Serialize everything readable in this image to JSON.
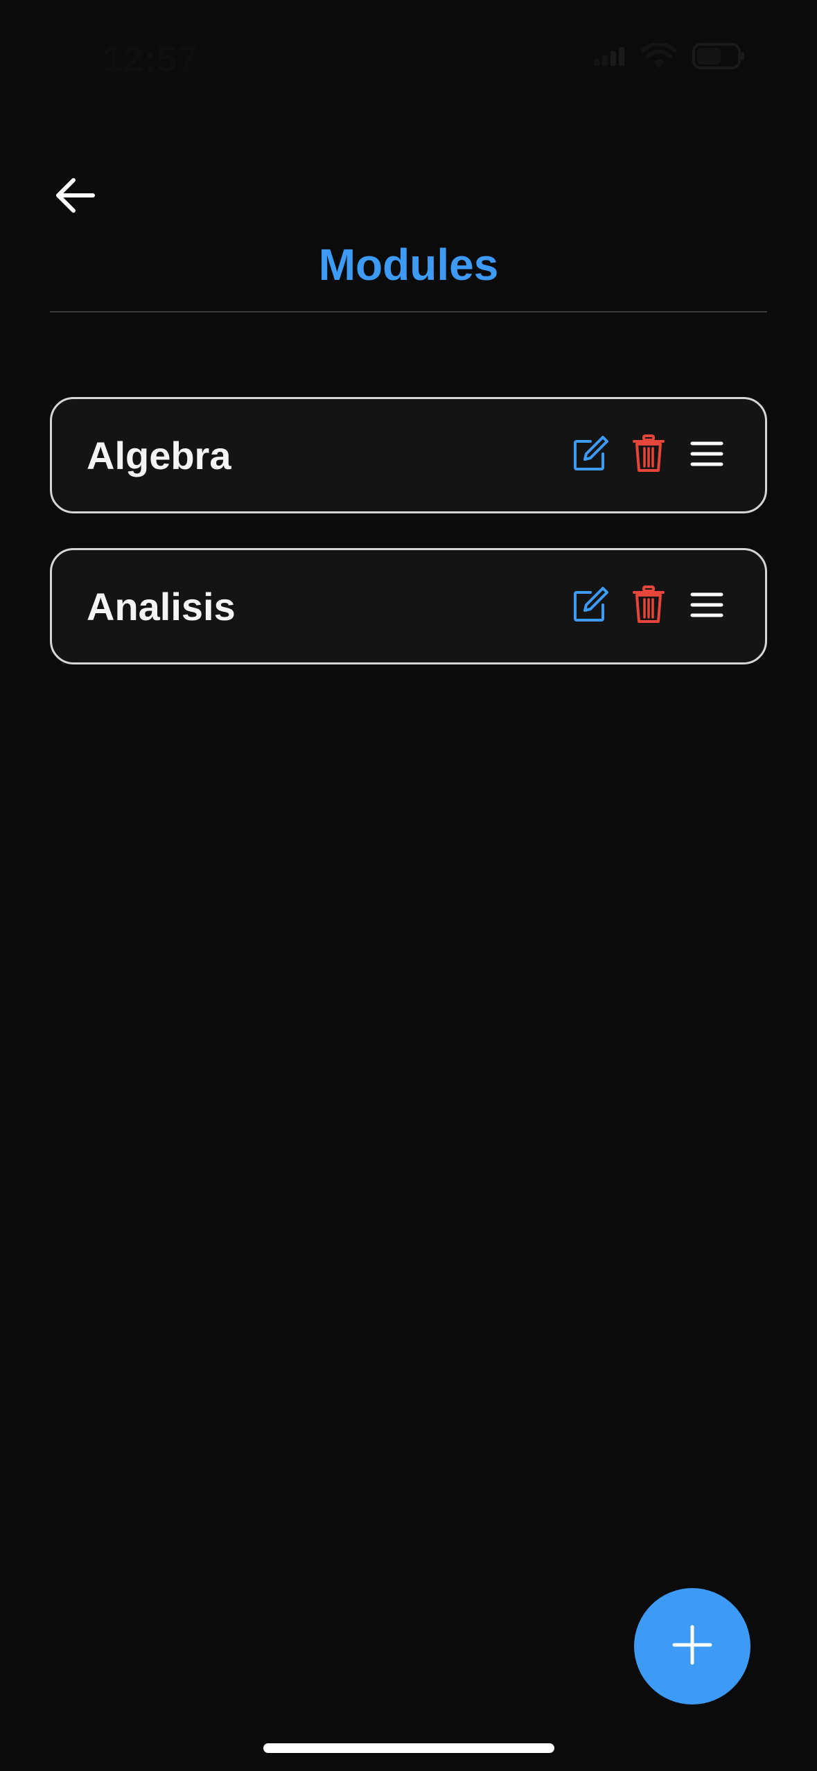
{
  "status_bar": {
    "time": "12:57"
  },
  "header": {
    "title": "Modules",
    "back_icon": "arrow-left-icon"
  },
  "modules": [
    {
      "name": "Algebra"
    },
    {
      "name": "Analisis"
    }
  ],
  "icons": {
    "edit": "edit-icon",
    "delete": "trash-icon",
    "reorder": "drag-handle-icon",
    "add": "plus-icon"
  },
  "colors": {
    "accent": "#3d9bf5",
    "danger": "#e5453b",
    "background": "#0b0b0c",
    "card": "#141415",
    "card_border": "#d6d6d8"
  }
}
